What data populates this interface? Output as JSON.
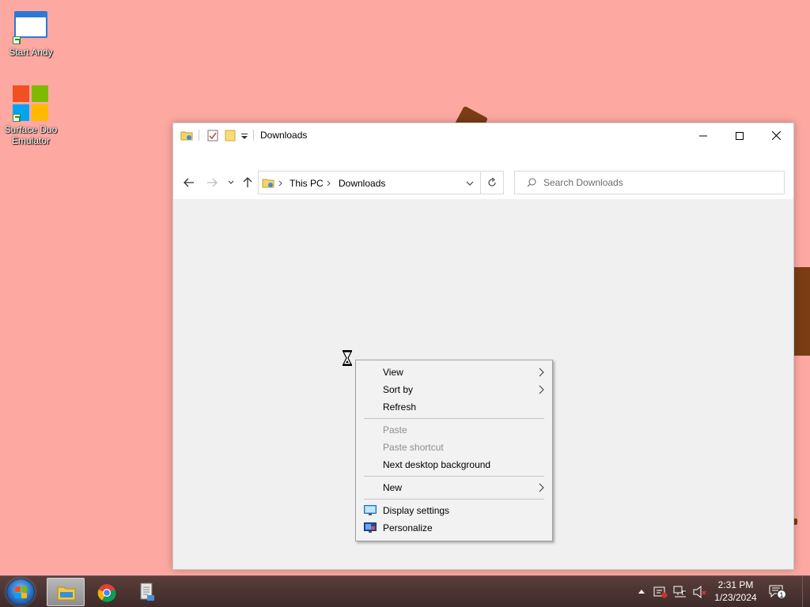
{
  "desktop": {
    "icons": [
      {
        "label": "Start Andy",
        "icon": "window-app-icon"
      },
      {
        "label": "Surface Duo Emulator",
        "icon": "microsoft-logo-icon"
      }
    ]
  },
  "window": {
    "title": "Downloads",
    "quick_access": [
      "folder-icon",
      "properties-check-icon",
      "new-folder-icon",
      "customize-dropdown-icon"
    ],
    "controls": [
      "minimize-icon",
      "maximize-icon",
      "close-icon"
    ]
  },
  "navigation": {
    "breadcrumb": [
      "This PC",
      "Downloads"
    ],
    "search_placeholder": "Search Downloads"
  },
  "context_menu": {
    "items": [
      {
        "label": "View",
        "submenu": true,
        "disabled": false
      },
      {
        "label": "Sort by",
        "submenu": true,
        "disabled": false
      },
      {
        "label": "Refresh",
        "submenu": false,
        "disabled": false
      },
      {
        "label": "Paste",
        "submenu": false,
        "disabled": true
      },
      {
        "label": "Paste shortcut",
        "submenu": false,
        "disabled": true
      },
      {
        "label": "Next desktop background",
        "submenu": false,
        "disabled": false
      },
      {
        "label": "New",
        "submenu": true,
        "disabled": false
      },
      {
        "label": "Display settings",
        "submenu": false,
        "disabled": false,
        "icon": "display-settings-icon"
      },
      {
        "label": "Personalize",
        "submenu": false,
        "disabled": false,
        "icon": "personalize-icon"
      }
    ]
  },
  "taskbar": {
    "apps": [
      "start-orb",
      "file-explorer-icon",
      "chrome-icon",
      "document-app-icon"
    ],
    "time": "2:31 PM",
    "date": "1/23/2024",
    "notification_count": "1"
  },
  "colors": {
    "desktop_background": "#fda9a2",
    "window_background": "#f0f0f0",
    "taskbar": "#3e2b29",
    "accent": "#2e78d6"
  }
}
